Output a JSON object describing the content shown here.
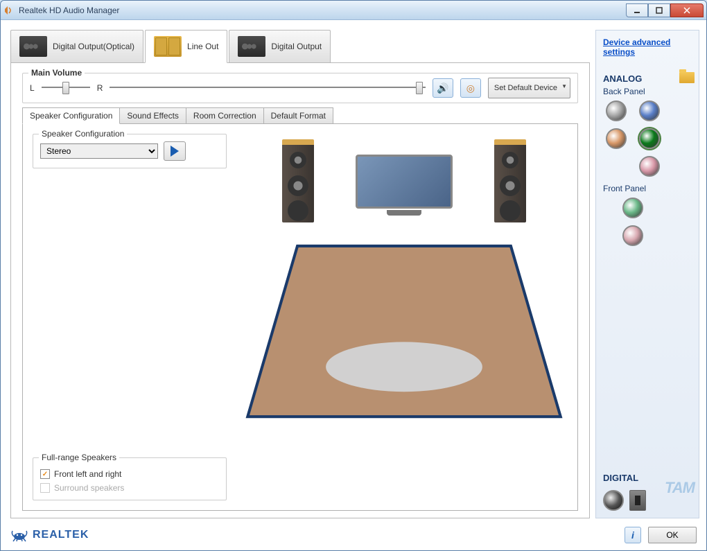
{
  "window": {
    "title": "Realtek HD Audio Manager"
  },
  "topTabs": [
    {
      "label": "Digital Output(Optical)"
    },
    {
      "label": "Line Out"
    },
    {
      "label": "Digital Output"
    }
  ],
  "advancedLink": "Device advanced settings",
  "mainVolume": {
    "title": "Main Volume",
    "leftLabel": "L",
    "rightLabel": "R",
    "defaultBtn": "Set Default Device"
  },
  "subTabs": [
    {
      "label": "Speaker Configuration"
    },
    {
      "label": "Sound Effects"
    },
    {
      "label": "Room Correction"
    },
    {
      "label": "Default Format"
    }
  ],
  "speakerConfig": {
    "title": "Speaker Configuration",
    "selected": "Stereo"
  },
  "fullRange": {
    "title": "Full-range Speakers",
    "opt1": "Front left and right",
    "opt2": "Surround speakers"
  },
  "sidePanel": {
    "analog": "ANALOG",
    "backPanel": "Back Panel",
    "frontPanel": "Front Panel",
    "digital": "DIGITAL"
  },
  "jackColors": {
    "grey": "#a8a8a8",
    "blue": "#5a7fc8",
    "orange": "#d89868",
    "green": "#2a9a3a",
    "pink": "#d898a8",
    "fgreen": "#6ab888",
    "fpink": "#d8a8b0"
  },
  "footer": {
    "brand": "REALTEK",
    "ok": "OK",
    "info": "i"
  }
}
